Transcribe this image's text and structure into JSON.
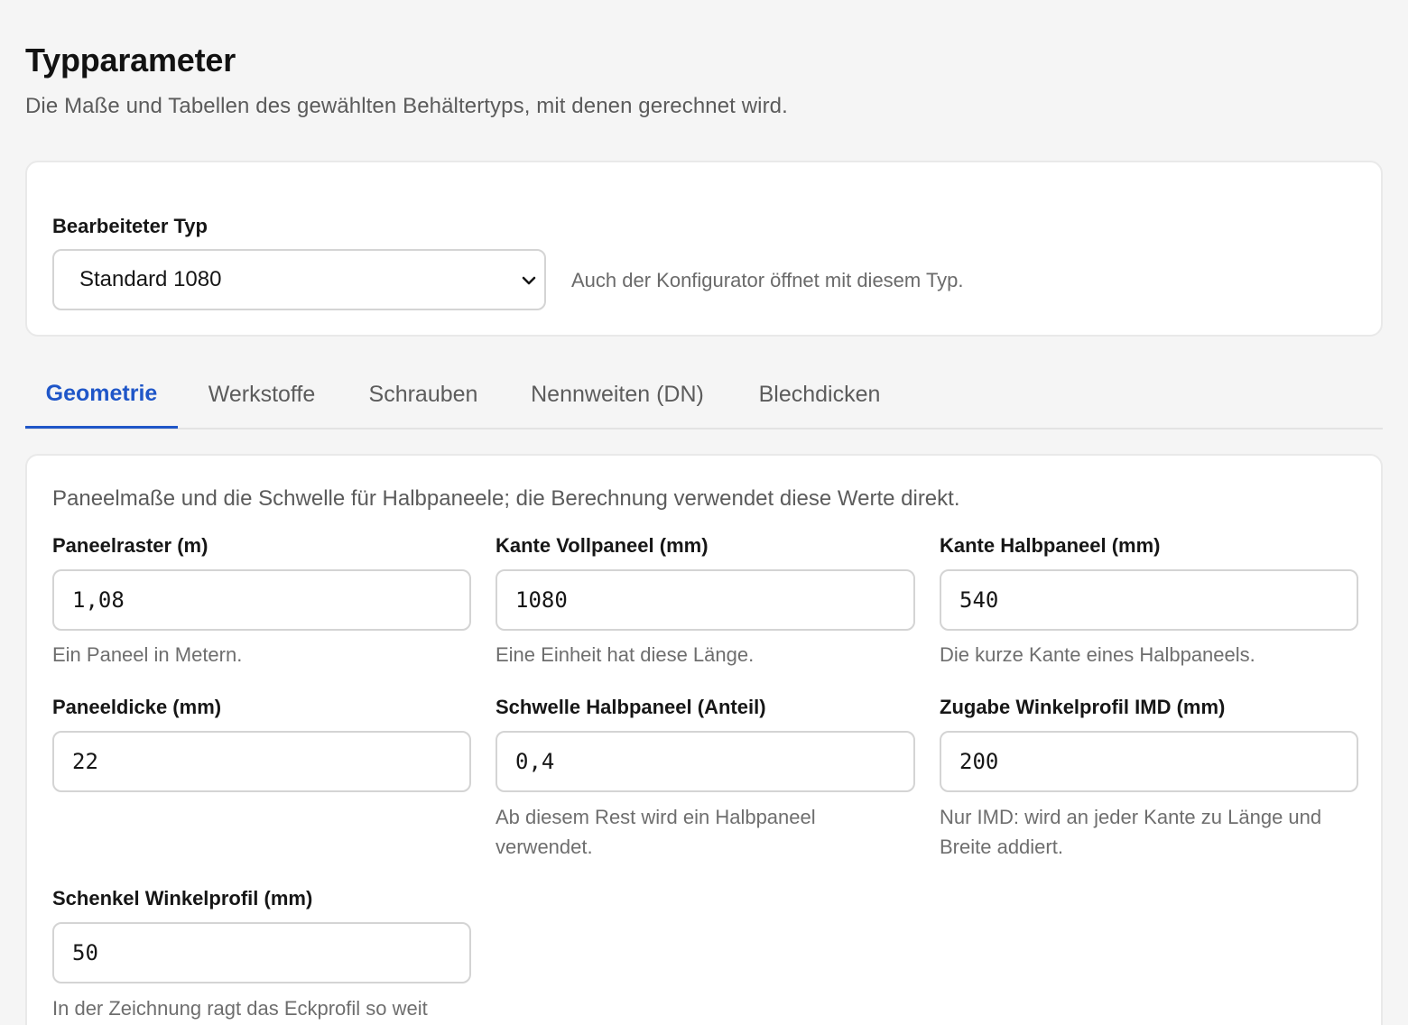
{
  "header": {
    "title": "Typparameter",
    "subtitle": "Die Maße und Tabellen des gewählten Behältertyps, mit denen gerechnet wird."
  },
  "type_selector": {
    "label": "Bearbeiteter Typ",
    "selected": "Standard 1080",
    "hint": "Auch der Konfigurator öffnet mit diesem Typ."
  },
  "tabs": [
    {
      "label": "Geometrie",
      "active": true
    },
    {
      "label": "Werkstoffe",
      "active": false
    },
    {
      "label": "Schrauben",
      "active": false
    },
    {
      "label": "Nennweiten (DN)",
      "active": false
    },
    {
      "label": "Blechdicken",
      "active": false
    }
  ],
  "geometry": {
    "intro": "Paneelmaße und die Schwelle für Halbpaneele; die Berechnung verwendet diese Werte direkt.",
    "fields": [
      {
        "label": "Paneelraster (m)",
        "value": "1,08",
        "help": "Ein Paneel in Metern."
      },
      {
        "label": "Kante Vollpaneel (mm)",
        "value": "1080",
        "help": "Eine Einheit hat diese Länge."
      },
      {
        "label": "Kante Halbpaneel (mm)",
        "value": "540",
        "help": "Die kurze Kante eines Halbpaneels."
      },
      {
        "label": "Paneeldicke (mm)",
        "value": "22",
        "help": ""
      },
      {
        "label": "Schwelle Halbpaneel (Anteil)",
        "value": "0,4",
        "help": "Ab diesem Rest wird ein Halbpaneel verwendet."
      },
      {
        "label": "Zugabe Winkelprofil IMD (mm)",
        "value": "200",
        "help": "Nur IMD: wird an jeder Kante zu Länge und Breite addiert."
      },
      {
        "label": "Schenkel Winkelprofil (mm)",
        "value": "50",
        "help": "In der Zeichnung ragt das Eckprofil so weit"
      }
    ]
  },
  "colors": {
    "accent": "#1f56c8",
    "background": "#f5f5f5",
    "card": "#ffffff"
  }
}
